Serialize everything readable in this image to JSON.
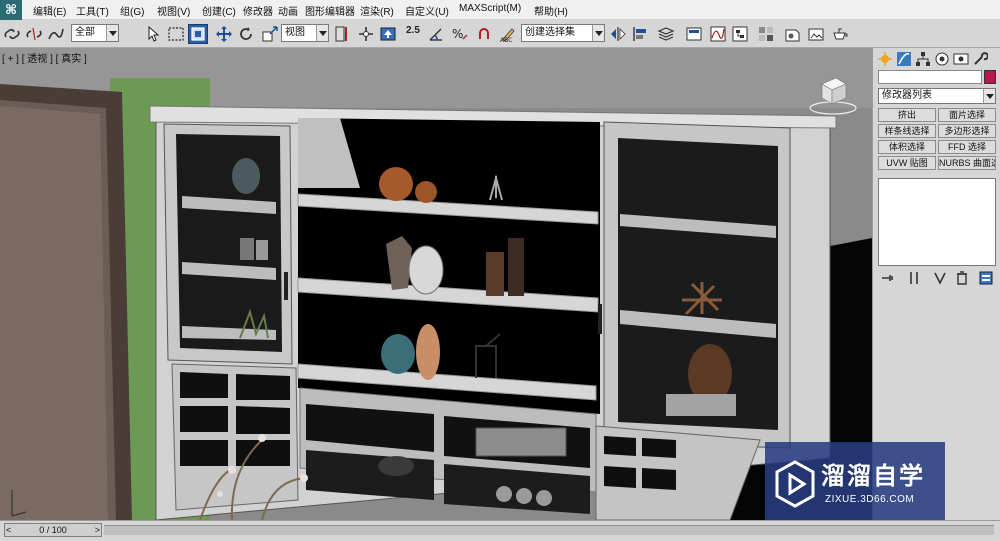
{
  "menu": {
    "items": [
      "编辑(E)",
      "工具(T)",
      "组(G)",
      "视图(V)",
      "创建(C)",
      "修改器",
      "动画",
      "图形编辑器",
      "渲染(R)",
      "自定义(U)",
      "MAXScript(M)",
      "帮助(H)"
    ]
  },
  "toolbar": {
    "selection_filter": "全部",
    "ref_coord_system": "视图",
    "angle_snap_label": "2.5",
    "named_selection_set": "创建选择集",
    "colors": {
      "active_button": "#2b5ea3"
    }
  },
  "viewport": {
    "label_prefix": "[ + ]",
    "label_view": "[ 透视 ]",
    "label_shading": "[ 真实 ]",
    "viewcube_icon": "viewcube-icon"
  },
  "command_panel": {
    "tabs": [
      "create-icon",
      "modify-icon",
      "hierarchy-icon",
      "motion-icon",
      "display-icon",
      "utilities-icon"
    ],
    "object_name": "",
    "object_color": "#b51a4a",
    "modifier_list": "修改器列表",
    "modifier_buttons": [
      "挤出",
      "面片选择",
      "样条线选择",
      "多边形选择",
      "体积选择",
      "FFD 选择",
      "UVW 贴图",
      "NURBS 曲面选择"
    ],
    "stack_tools": [
      "pin-stack-icon",
      "show-end-result-icon",
      "make-unique-icon",
      "remove-modifier-icon",
      "configure-sets-icon"
    ]
  },
  "watermark": {
    "title": "溜溜自学",
    "url": "ZIXUE.3D66.COM",
    "logo_icon": "play-logo-icon"
  },
  "timeline": {
    "frame_readout": "0 / 100",
    "prev_label": "<",
    "next_label": ">"
  }
}
